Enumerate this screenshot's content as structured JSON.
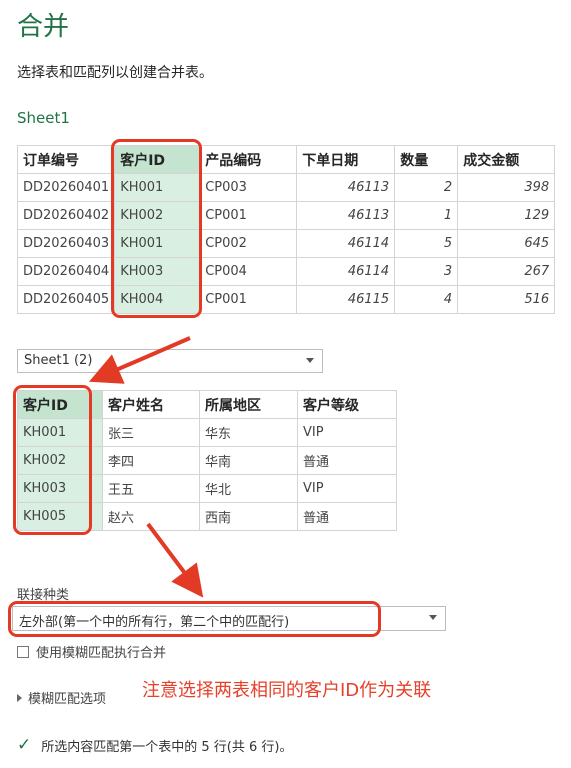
{
  "dialog": {
    "title": "合并",
    "subtitle": "选择表和匹配列以创建合并表。",
    "first_table_name": "Sheet1",
    "second_table_select": "Sheet1 (2)",
    "join_kind_label": "联接种类",
    "join_kind_value": "左外部(第一个中的所有行，第二个中的匹配行)",
    "fuzzy_checkbox_label": "使用模糊匹配执行合并",
    "fuzzy_options_label": "模糊匹配选项",
    "status_text": "所选内容匹配第一个表中的 5 行(共 6 行)。"
  },
  "table1": {
    "headers": [
      "订单编号",
      "客户ID",
      "产品编码",
      "下单日期",
      "数量",
      "成交金额"
    ],
    "rows": [
      [
        "DD20260401",
        "KH001",
        "CP003",
        "46113",
        "2",
        "398"
      ],
      [
        "DD20260402",
        "KH002",
        "CP001",
        "46113",
        "1",
        "129"
      ],
      [
        "DD20260403",
        "KH001",
        "CP002",
        "46114",
        "5",
        "645"
      ],
      [
        "DD20260404",
        "KH003",
        "CP004",
        "46114",
        "3",
        "267"
      ],
      [
        "DD20260405",
        "KH004",
        "CP001",
        "46115",
        "4",
        "516"
      ]
    ]
  },
  "table2": {
    "headers": [
      "客户ID",
      "客户姓名",
      "所属地区",
      "客户等级"
    ],
    "rows": [
      [
        "KH001",
        "张三",
        "华东",
        "VIP"
      ],
      [
        "KH002",
        "李四",
        "华南",
        "普通"
      ],
      [
        "KH003",
        "王五",
        "华北",
        "VIP"
      ],
      [
        "KH005",
        "赵六",
        "西南",
        "普通"
      ]
    ]
  },
  "annotation": {
    "note": "注意选择两表相同的客户ID作为关联",
    "color": "#e8402a"
  },
  "colors": {
    "accent": "#217346",
    "highlight": "#d8efe1"
  }
}
